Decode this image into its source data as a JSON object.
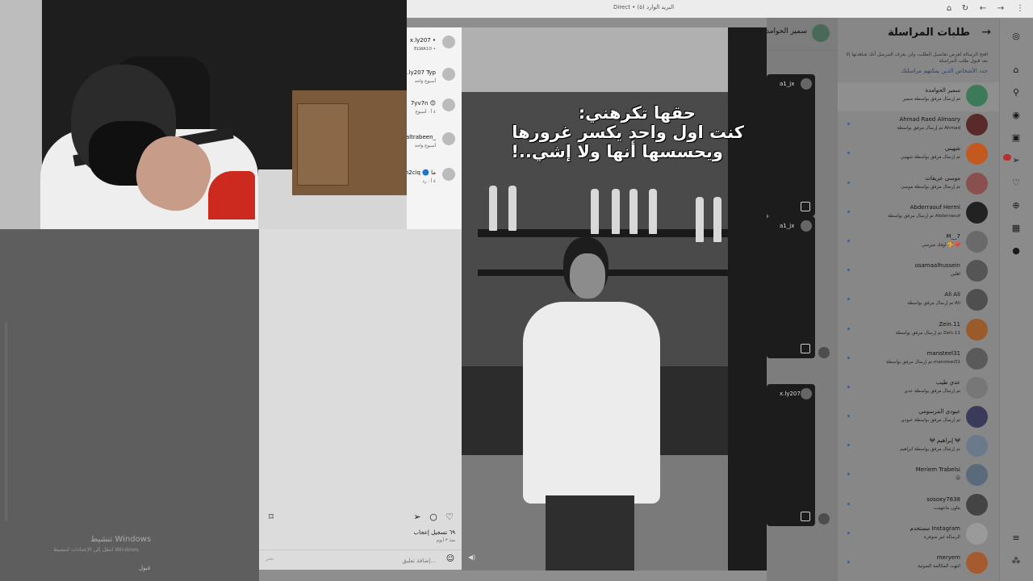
{
  "browser": {
    "tab_title": "Direct • (٥) البريد الوارد",
    "icons": [
      "home-icon",
      "reload-icon",
      "back-icon",
      "forward-icon",
      "menu-icon"
    ]
  },
  "requests_panel": {
    "title": "طلبات المراسلة",
    "description": "افتح الرسالة لعرض تفاصيل الطلب، ولن يعرف المرسل أنك شاهدتها إلا بعد قبول طلب المراسلة",
    "manage_link": "حدد الأشخاص الذين يمكنهم مراسلتك",
    "items": [
      {
        "name": "سمير الحوامدة",
        "message": "تم إرسال مرفق بواسطة سمير",
        "color": "#3c7a5a"
      },
      {
        "name": "Ahmad Raed Almasry",
        "message": "تم إرسال مرفق بواسطة Ahmad",
        "color": "#5a2a2a"
      },
      {
        "name": "شهيني",
        "message": "تم إرسال مرفق بواسطة شهيني",
        "color": "#c25a20"
      },
      {
        "name": "موسى عريقات",
        "message": "تم إرسال مرفق بواسطة موسى",
        "color": "#8a5050"
      },
      {
        "name": "Abderraouf Hermi",
        "message": "تم إرسال مرفق بواسطة Abderraouf",
        "color": "#222222"
      },
      {
        "name": "M__7",
        "message": "اوفك ميرسي 🥰 ❤️",
        "color": "#6a6a6a"
      },
      {
        "name": "osamaalhussein",
        "message": "اهلين",
        "color": "#555555"
      },
      {
        "name": "Ali Ali",
        "message": "تم إرسال مرفق بواسطة Ali",
        "color": "#4f4f4f"
      },
      {
        "name": "Zein.11",
        "message": "تم إرسال مرفق بواسطة Zein.11",
        "color": "#9a5a2a"
      },
      {
        "name": "mansteel31",
        "message": "تم إرسال مرفق بواسطة mansteel31",
        "color": "#5a5a5a"
      },
      {
        "name": "عدي طيب",
        "message": "تم إرسال مرفق بواسطة عدي",
        "color": "#777777"
      },
      {
        "name": "عبودي المرسومي",
        "message": "تم إرسال مرفق بواسطة عبودي",
        "color": "#3a3a5a"
      },
      {
        "name": "𖤍 إبراهيم 𖤍",
        "message": "تم إرسال مرفق بواسطة ابراهيم",
        "color": "#6a7a8a"
      },
      {
        "name": "Meriem Trabelsi",
        "message": "😮",
        "color": "#5a6a7a"
      },
      {
        "name": "sosoxy7838",
        "message": "بتلون ماعهمت",
        "color": "#444444"
      },
      {
        "name": "مستخدم Instagram",
        "message": "الرسالة غير متوفرة",
        "color": "#9a9a9a"
      },
      {
        "name": "meryem",
        "message": "انتهت المكالمة الصوتية",
        "color": "#a55a30"
      }
    ]
  },
  "dm_header": {
    "name": "سمير الحوامدة"
  },
  "reel_cards": [
    {
      "user": "a1_jx"
    },
    {
      "user": "a1_jx"
    },
    {
      "user": "x.ly207"
    }
  ],
  "chat_list": [
    {
      "name": "x.ly207 •",
      "sub": "ELWA10 •"
    },
    {
      "name": "x.ly207 Typ",
      "sub": "أسبوع واحد"
    },
    {
      "name": "7yv7n 😊",
      "sub": "٤ أ · أسبوع"
    },
    {
      "name": "altrabeen_",
      "sub": "أسبوع واحد"
    },
    {
      "name": "m2ciq 🔵 ما",
      "sub": "٤ أ · رد"
    }
  ],
  "post": {
    "likes": "٦٩ تسجيل إعجاب",
    "time": "منذ ٣ أيوم",
    "comment_placeholder": "إضافة تعليق...",
    "post_label": "نشر",
    "caption": [
      "حقها تكرهني:",
      "كنت اول واحد يكسر غرورها",
      "ويحسسها أنها ولا إشي..!"
    ]
  },
  "windows_watermark": {
    "title": "تنشيط Windows",
    "subtitle": "انتقل إلى الإعدادات لتنشيط Windows.",
    "ok": "قبول"
  }
}
